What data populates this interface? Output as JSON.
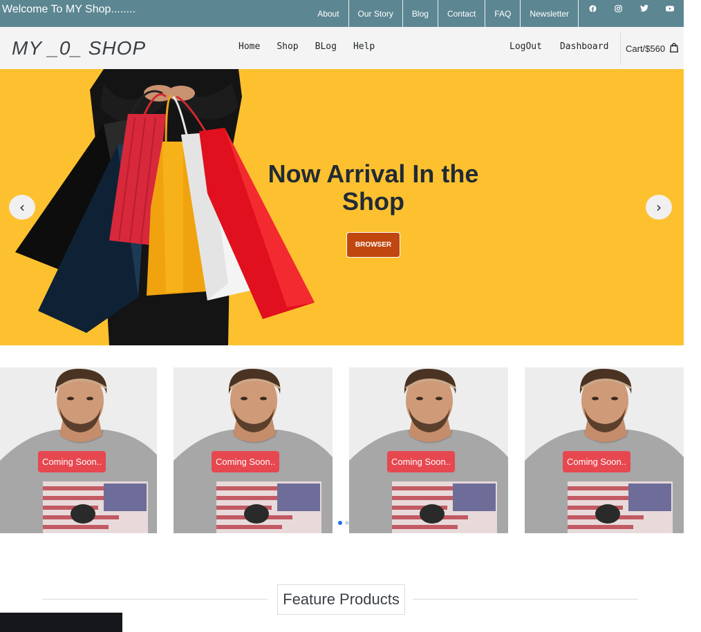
{
  "topbar": {
    "welcome": "Welcome To MY Shop........",
    "links": [
      "About",
      "Our Story",
      "Blog",
      "Contact",
      "FAQ",
      "Newsletter"
    ],
    "socials": [
      "facebook-icon",
      "instagram-icon",
      "twitter-icon",
      "youtube-icon"
    ],
    "bg_color": "#5c8692"
  },
  "header": {
    "logo": "MY _0_ SHOP",
    "nav": [
      "Home",
      "Shop",
      "BLog",
      "Help"
    ],
    "right_nav": [
      "LogOut",
      "Dashboard"
    ],
    "cart": "Cart/$560"
  },
  "hero": {
    "title": "Now Arrival In the Shop",
    "button": "BROWSER",
    "prev": "‹",
    "next": "›",
    "bg_color": "#fdc130",
    "button_color": "#c0470f"
  },
  "products": {
    "badges": [
      "Coming Soon..",
      "Coming Soon..",
      "Coming Soon..",
      "Coming Soon.."
    ],
    "badge_color": "#e7474f"
  },
  "feature": {
    "title": "Feature Products"
  }
}
